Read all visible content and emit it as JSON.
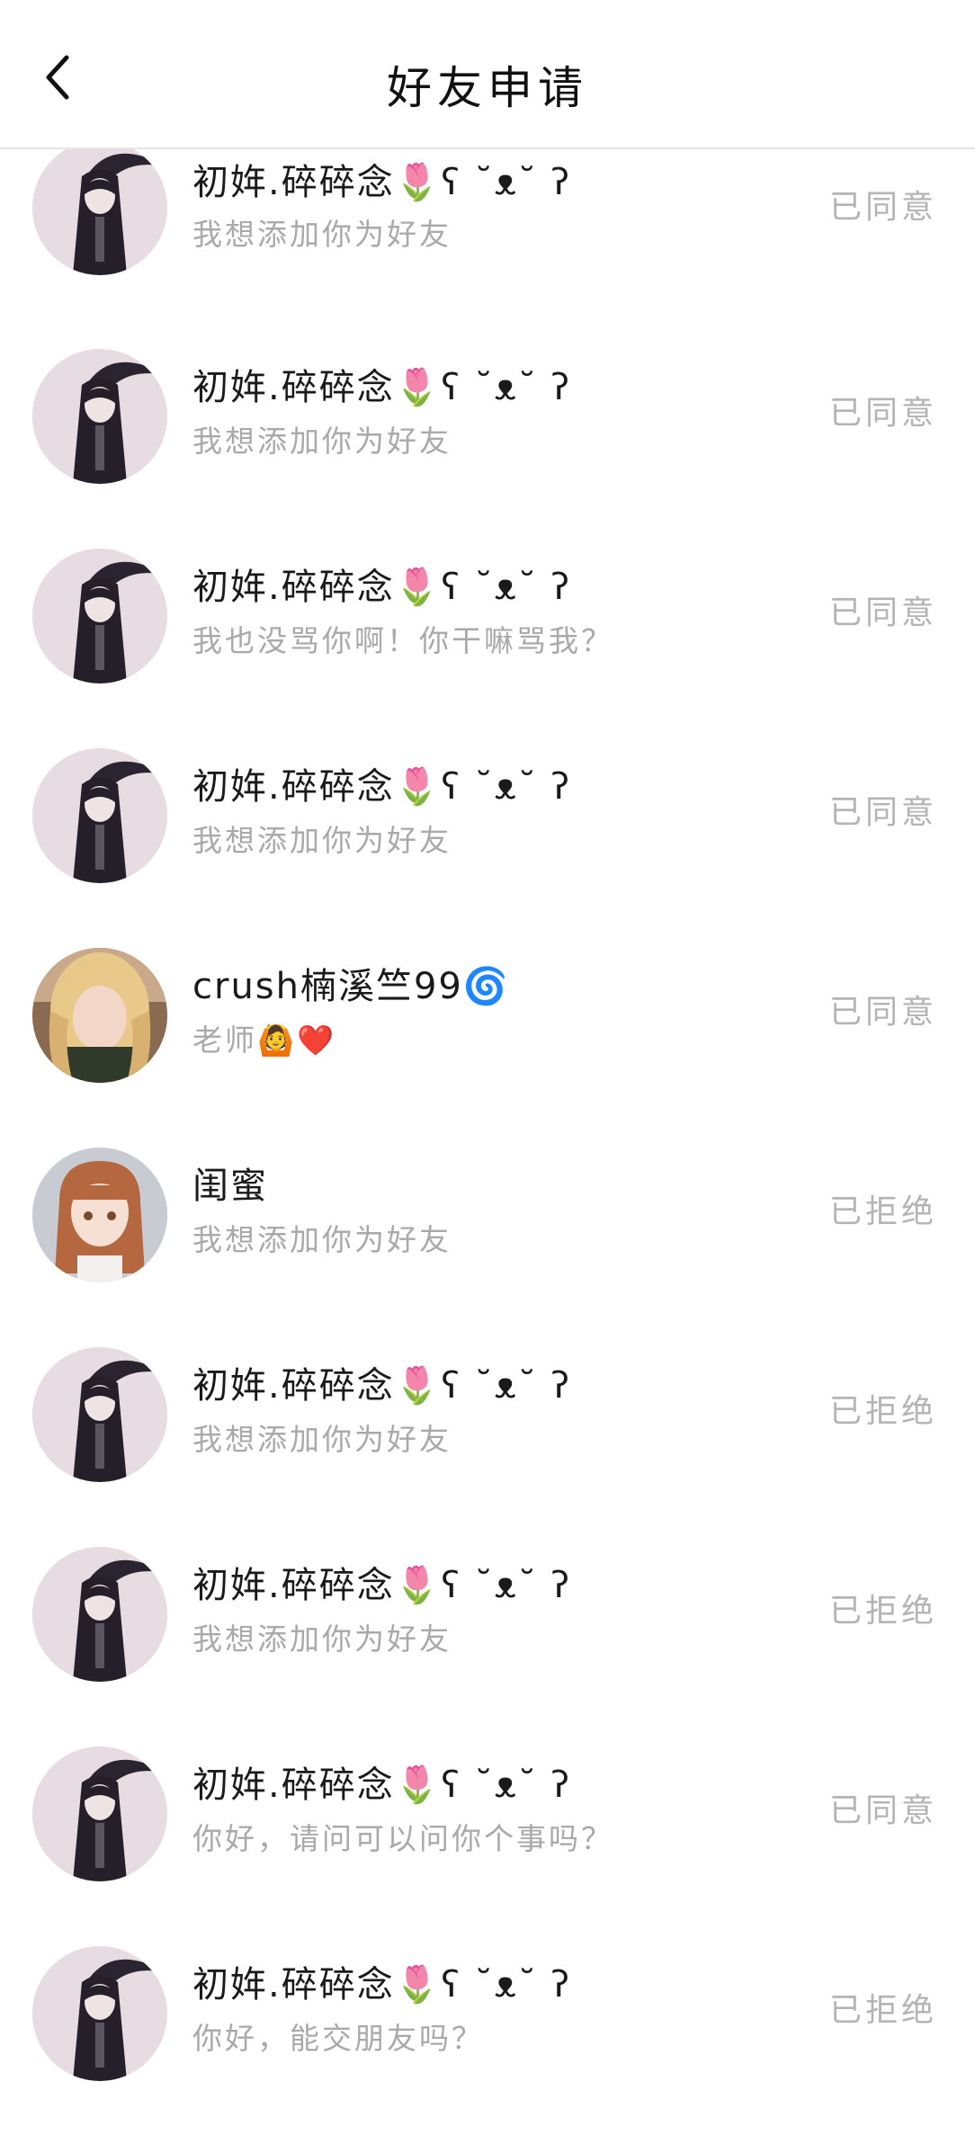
{
  "header": {
    "title": "好友申请",
    "back_icon": "chevron-left-icon"
  },
  "requests": [
    {
      "name": "初姩.碎碎念🌷ʕ ˘ᴥ˘ ʔ",
      "message": "我想添加你为好友",
      "status": "已同意",
      "avatar": "anime-girl-dark"
    },
    {
      "name": "初姩.碎碎念🌷ʕ ˘ᴥ˘ ʔ",
      "message": "我想添加你为好友",
      "status": "已同意",
      "avatar": "anime-girl-dark"
    },
    {
      "name": "初姩.碎碎念🌷ʕ ˘ᴥ˘ ʔ",
      "message": "我也没骂你啊！你干嘛骂我？",
      "status": "已同意",
      "avatar": "anime-girl-dark"
    },
    {
      "name": "初姩.碎碎念🌷ʕ ˘ᴥ˘ ʔ",
      "message": "我想添加你为好友",
      "status": "已同意",
      "avatar": "anime-girl-dark"
    },
    {
      "name": "crush楠溪竺99🌀",
      "message": "老师🙆❤️",
      "status": "已同意",
      "avatar": "photo-blonde"
    },
    {
      "name": "闺蜜",
      "message": "我想添加你为好友",
      "status": "已拒绝",
      "avatar": "anime-girl-brown"
    },
    {
      "name": "初姩.碎碎念🌷ʕ ˘ᴥ˘ ʔ",
      "message": "我想添加你为好友",
      "status": "已拒绝",
      "avatar": "anime-girl-dark"
    },
    {
      "name": "初姩.碎碎念🌷ʕ ˘ᴥ˘ ʔ",
      "message": "我想添加你为好友",
      "status": "已拒绝",
      "avatar": "anime-girl-dark"
    },
    {
      "name": "初姩.碎碎念🌷ʕ ˘ᴥ˘ ʔ",
      "message": "你好，请问可以问你个事吗？",
      "status": "已同意",
      "avatar": "anime-girl-dark"
    },
    {
      "name": "初姩.碎碎念🌷ʕ ˘ᴥ˘ ʔ",
      "message": "你好，能交朋友吗？",
      "status": "已拒绝",
      "avatar": "anime-girl-dark"
    }
  ]
}
